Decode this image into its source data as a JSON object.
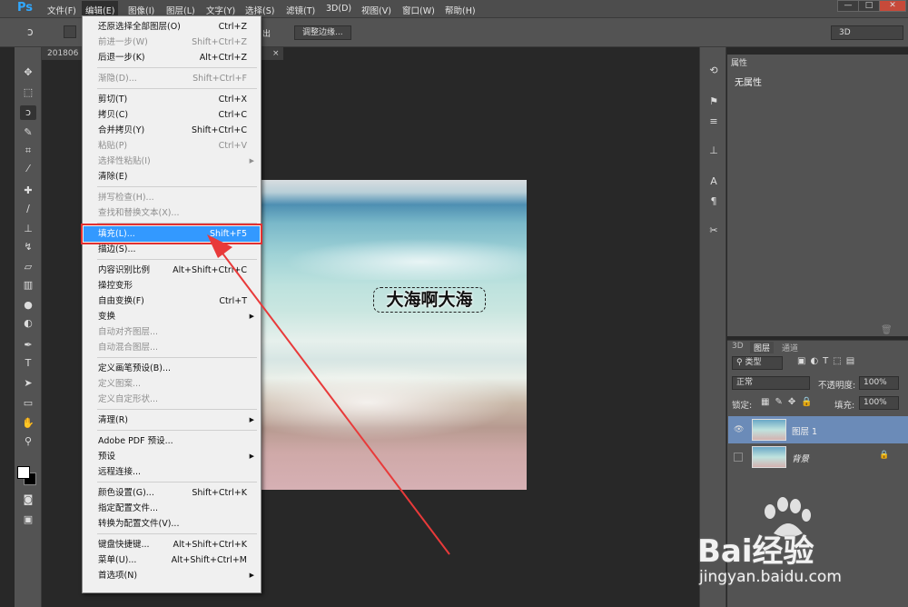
{
  "app": {
    "logo": "Ps"
  },
  "menubar": {
    "items": [
      "文件(F)",
      "编辑(E)",
      "图像(I)",
      "图层(L)",
      "文字(Y)",
      "选择(S)",
      "滤镜(T)",
      "3D(D)",
      "视图(V)",
      "窗口(W)",
      "帮助(H)"
    ],
    "window_buttons": [
      "—",
      "□",
      "✕"
    ]
  },
  "options": {
    "refine_edge_label": "调整边缘...",
    "clip_text": "出",
    "workspace_value": "3D"
  },
  "document": {
    "tab_label": "201806"
  },
  "canvas": {
    "overlay_text": "大海啊大海"
  },
  "edit_menu": {
    "items": [
      {
        "label": "还原选择全部图层(O)",
        "shortcut": "Ctrl+Z",
        "disabled": false
      },
      {
        "label": "前进一步(W)",
        "shortcut": "Shift+Ctrl+Z",
        "disabled": true
      },
      {
        "label": "后退一步(K)",
        "shortcut": "Alt+Ctrl+Z",
        "disabled": false
      },
      {
        "sep": true
      },
      {
        "label": "渐隐(D)...",
        "shortcut": "Shift+Ctrl+F",
        "disabled": true
      },
      {
        "sep": true
      },
      {
        "label": "剪切(T)",
        "shortcut": "Ctrl+X",
        "disabled": false
      },
      {
        "label": "拷贝(C)",
        "shortcut": "Ctrl+C",
        "disabled": false
      },
      {
        "label": "合并拷贝(Y)",
        "shortcut": "Shift+Ctrl+C",
        "disabled": false
      },
      {
        "label": "粘贴(P)",
        "shortcut": "Ctrl+V",
        "disabled": true
      },
      {
        "label": "选择性粘贴(I)",
        "shortcut": "",
        "disabled": true,
        "submenu": true
      },
      {
        "label": "清除(E)",
        "shortcut": "",
        "disabled": false
      },
      {
        "sep": true
      },
      {
        "label": "拼写检查(H)...",
        "shortcut": "",
        "disabled": true
      },
      {
        "label": "查找和替换文本(X)...",
        "shortcut": "",
        "disabled": true
      },
      {
        "sep": true
      },
      {
        "label": "填充(L)...",
        "shortcut": "Shift+F5",
        "disabled": false,
        "highlight": true
      },
      {
        "label": "描边(S)...",
        "shortcut": "",
        "disabled": false
      },
      {
        "sep": true
      },
      {
        "label": "内容识别比例",
        "shortcut": "Alt+Shift+Ctrl+C",
        "disabled": false
      },
      {
        "label": "操控变形",
        "shortcut": "",
        "disabled": false
      },
      {
        "label": "自由变换(F)",
        "shortcut": "Ctrl+T",
        "disabled": false
      },
      {
        "label": "变换",
        "shortcut": "",
        "disabled": false,
        "submenu": true
      },
      {
        "label": "自动对齐图层...",
        "shortcut": "",
        "disabled": true
      },
      {
        "label": "自动混合图层...",
        "shortcut": "",
        "disabled": true
      },
      {
        "sep": true
      },
      {
        "label": "定义画笔预设(B)...",
        "shortcut": "",
        "disabled": false
      },
      {
        "label": "定义图案...",
        "shortcut": "",
        "disabled": true
      },
      {
        "label": "定义自定形状...",
        "shortcut": "",
        "disabled": true
      },
      {
        "sep": true
      },
      {
        "label": "清理(R)",
        "shortcut": "",
        "disabled": false,
        "submenu": true
      },
      {
        "sep": true
      },
      {
        "label": "Adobe PDF 预设...",
        "shortcut": "",
        "disabled": false
      },
      {
        "label": "预设",
        "shortcut": "",
        "disabled": false,
        "submenu": true
      },
      {
        "label": "远程连接...",
        "shortcut": "",
        "disabled": false
      },
      {
        "sep": true
      },
      {
        "label": "颜色设置(G)...",
        "shortcut": "Shift+Ctrl+K",
        "disabled": false
      },
      {
        "label": "指定配置文件...",
        "shortcut": "",
        "disabled": false
      },
      {
        "label": "转换为配置文件(V)...",
        "shortcut": "",
        "disabled": false
      },
      {
        "sep": true
      },
      {
        "label": "键盘快捷键...",
        "shortcut": "Alt+Shift+Ctrl+K",
        "disabled": false
      },
      {
        "label": "菜单(U)...",
        "shortcut": "Alt+Shift+Ctrl+M",
        "disabled": false
      },
      {
        "label": "首选项(N)",
        "shortcut": "",
        "disabled": false,
        "submenu": true
      }
    ]
  },
  "properties_panel": {
    "tab": "属性",
    "empty_text": "无属性"
  },
  "layers_panel": {
    "tabs": [
      "3D",
      "图层",
      "通道"
    ],
    "filter_label": "类型",
    "blend_mode": "正常",
    "opacity_label": "不透明度:",
    "opacity_value": "100%",
    "lock_label": "锁定:",
    "fill_label": "填充:",
    "fill_value": "100%",
    "layers": [
      {
        "name": "图层 1",
        "visible": true,
        "selected": true
      },
      {
        "name": "背景",
        "visible": false,
        "selected": false
      }
    ]
  },
  "watermark": {
    "brand": "Bai经验",
    "url": "jingyan.baidu.com"
  }
}
